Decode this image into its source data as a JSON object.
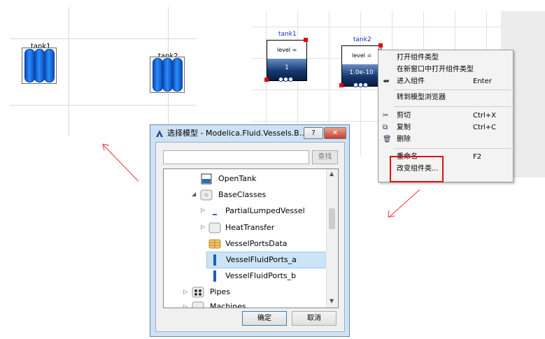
{
  "left_diagram": {
    "tank1_label": "tank1",
    "tank2_label": "tank2"
  },
  "right_diagram": {
    "tank1": {
      "label": "tank1",
      "level_text": "level =",
      "value": "1"
    },
    "tank2": {
      "label": "tank2",
      "level_text": "level =",
      "value": "1.0e-10"
    }
  },
  "context_menu": {
    "items": [
      {
        "label": "打开组件类型",
        "shortcut": "",
        "icon": ""
      },
      {
        "label": "在新窗口中打开组件类型",
        "shortcut": "",
        "icon": ""
      },
      {
        "label": "进入组件",
        "shortcut": "Enter",
        "icon": "enter-icon"
      },
      {
        "label": "转到模型浏览器",
        "shortcut": "",
        "icon": ""
      },
      {
        "label": "剪切",
        "shortcut": "Ctrl+X",
        "icon": "cut-icon"
      },
      {
        "label": "复制",
        "shortcut": "Ctrl+C",
        "icon": "copy-icon"
      },
      {
        "label": "删除",
        "shortcut": "",
        "icon": "delete-icon"
      },
      {
        "label": "重命名",
        "shortcut": "F2",
        "icon": ""
      },
      {
        "label": "改变组件类...",
        "shortcut": "",
        "icon": ""
      }
    ]
  },
  "dialog": {
    "title": "选择模型 - Modelica.Fluid.Vessels.B...",
    "help_label": "?",
    "close_label": "✕",
    "search_placeholder": "",
    "find_label": "查找",
    "tree": [
      {
        "label": "OpenTank",
        "icon": "open-tank-icon",
        "selected": false
      },
      {
        "label": "BaseClasses",
        "icon": "package-icon",
        "selected": false
      },
      {
        "label": "PartialLumpedVessel",
        "icon": "partial-vessel-icon",
        "selected": false
      },
      {
        "label": "HeatTransfer",
        "icon": "heat-transfer-icon",
        "selected": false
      },
      {
        "label": "VesselPortsData",
        "icon": "record-icon",
        "selected": false
      },
      {
        "label": "VesselFluidPorts_a",
        "icon": "fluid-port-icon",
        "selected": true
      },
      {
        "label": "VesselFluidPorts_b",
        "icon": "fluid-port-icon",
        "selected": false
      },
      {
        "label": "Pipes",
        "icon": "pipes-package-icon",
        "selected": false
      },
      {
        "label": "Machines",
        "icon": "machines-package-icon",
        "selected": false
      }
    ],
    "ok_label": "确定",
    "cancel_label": "取消"
  },
  "colors": {
    "accent_red": "#e01010",
    "tank_blue": "#1a6fe0",
    "selection": "#cce4f7"
  }
}
